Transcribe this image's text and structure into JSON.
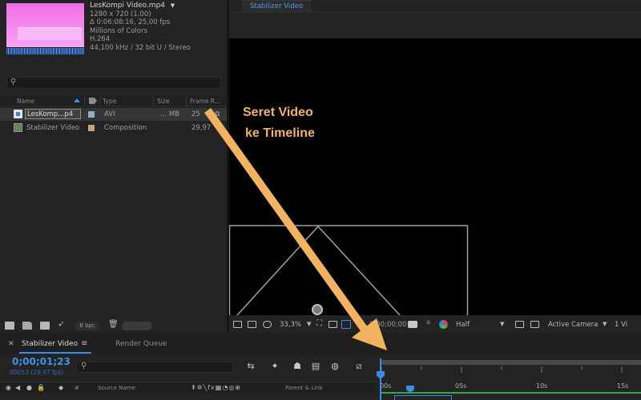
{
  "project": {
    "file": {
      "name": "LesKompi Video.mp4",
      "resolution": "1280 x 720 (1,00)",
      "duration": "Δ 0:06:08:16, 25,00 fps",
      "colors": "Millions of Colors",
      "codec": "H.264",
      "audio": "44,100 kHz / 32 bit U / Stereo"
    },
    "columns": {
      "name": "Name",
      "type": "Type",
      "size": "Size",
      "frame_rate": "Frame R..."
    },
    "items": [
      {
        "name": "LesKomp...p4",
        "type": "AVI",
        "size": "... MB",
        "frame_rate": "25",
        "label_color": "#8fb4c8",
        "icon": "footage-file-icon"
      },
      {
        "name": "Stabilizer Video",
        "type": "Composition",
        "size": "",
        "frame_rate": "29,97",
        "label_color": "#c4a27c",
        "icon": "composition-icon"
      }
    ],
    "bottom": {
      "bpc": "8 bpc"
    }
  },
  "viewer": {
    "tab": "Stabilizer Video",
    "zoom": "33,3%",
    "timecode": "0;00;00;00",
    "resolution": "Half",
    "camera": "Active Camera",
    "views": "1 Vi"
  },
  "annotation": {
    "line1": "Seret Video",
    "line2": "ke Timeline",
    "color": "#f2b35f"
  },
  "timeline": {
    "tab": "Stabilizer Video",
    "render_queue": "Render Queue",
    "timecode": "0;00;01;23",
    "frames": "00053 (29.97 fps)",
    "layer_header": {
      "source_name": "Source Name",
      "parent": "Parent & Link",
      "hash": "#"
    },
    "ruler": [
      "00s",
      "05s",
      "10s",
      "15s"
    ]
  },
  "colors": {
    "accent": "#3b8ce6",
    "panel": "#232323",
    "annotation": "#f2b35f"
  }
}
